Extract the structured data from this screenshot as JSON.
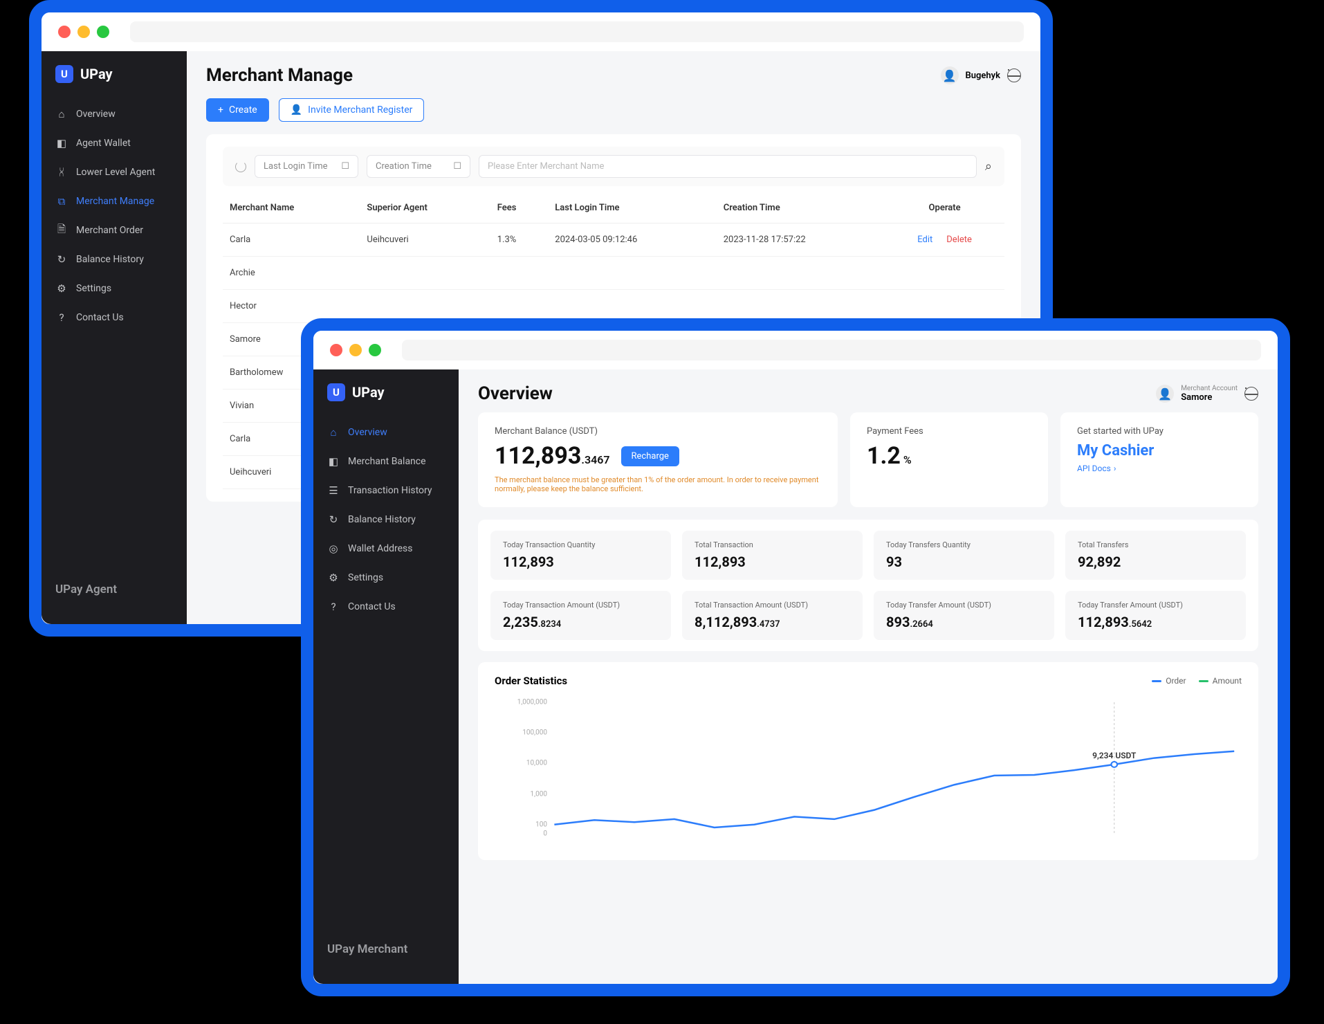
{
  "agent": {
    "appName": "UPay",
    "footer": "UPay Agent",
    "pageTitle": "Merchant Manage",
    "userName": "Bugehyk",
    "nav": [
      {
        "icon": "⌂",
        "label": "Overview"
      },
      {
        "icon": "◧",
        "label": "Agent Wallet"
      },
      {
        "icon": "⩆",
        "label": "Lower Level Agent"
      },
      {
        "icon": "⧉",
        "label": "Merchant Manage",
        "active": true
      },
      {
        "icon": "🗎",
        "label": "Merchant Order"
      },
      {
        "icon": "↻",
        "label": "Balance History"
      },
      {
        "icon": "⚙",
        "label": "Settings"
      },
      {
        "icon": "?",
        "label": "Contact Us"
      }
    ],
    "createBtn": "Create",
    "inviteBtn": "Invite Merchant Register",
    "filters": {
      "lastLogin": "Last Login Time",
      "creation": "Creation Time",
      "searchPlaceholder": "Please Enter Merchant Name"
    },
    "columns": [
      "Merchant Name",
      "Superior Agent",
      "Fees",
      "Last Login Time",
      "Creation Time",
      "Operate"
    ],
    "rows": [
      {
        "name": "Carla",
        "agent": "Ueihcuveri",
        "fees": "1.3%",
        "last": "2024-03-05  09:12:46",
        "created": "2023-11-28  17:57:22"
      },
      {
        "name": "Archie"
      },
      {
        "name": "Hector"
      },
      {
        "name": "Samore"
      },
      {
        "name": "Bartholomew"
      },
      {
        "name": "Vivian"
      },
      {
        "name": "Carla"
      },
      {
        "name": "Ueihcuveri"
      }
    ],
    "opEdit": "Edit",
    "opDelete": "Delete"
  },
  "merchant": {
    "appName": "UPay",
    "footer": "UPay Merchant",
    "pageTitle": "Overview",
    "userLabel": "Merchant Account",
    "userName": "Samore",
    "nav": [
      {
        "icon": "⌂",
        "label": "Overview",
        "active": true
      },
      {
        "icon": "◧",
        "label": "Merchant Balance"
      },
      {
        "icon": "☰",
        "label": "Transaction History"
      },
      {
        "icon": "↻",
        "label": "Balance History"
      },
      {
        "icon": "◎",
        "label": "Wallet Address"
      },
      {
        "icon": "⚙",
        "label": "Settings"
      },
      {
        "icon": "?",
        "label": "Contact Us"
      }
    ],
    "balance": {
      "label": "Merchant Balance (USDT)",
      "value": "112,893",
      "dec": ".3467",
      "recharge": "Recharge",
      "warn": "The merchant balance must be greater than 1% of the order amount. In order to receive payment normally, please keep the balance sufficient."
    },
    "fees": {
      "label": "Payment Fees",
      "value": "1.2",
      "unit": "%"
    },
    "getStarted": {
      "label": "Get started with UPay",
      "cashier": "My Cashier",
      "api": "API Docs"
    },
    "stats": [
      {
        "lbl": "Today Transaction Quantity",
        "val": "112,893"
      },
      {
        "lbl": "Total Transaction",
        "val": "112,893"
      },
      {
        "lbl": "Today Transfers Quantity",
        "val": "93"
      },
      {
        "lbl": "Total Transfers",
        "val": "92,892"
      },
      {
        "lbl": "Today Transaction Amount (USDT)",
        "val": "2,235",
        "dec": ".8234"
      },
      {
        "lbl": "Total Transaction Amount (USDT)",
        "val": "8,112,893",
        "dec": ".4737"
      },
      {
        "lbl": "Today Transfer Amount (USDT)",
        "val": "893",
        "dec": ".2664"
      },
      {
        "lbl": "Today Transfer Amount (USDT)",
        "val": "112,893",
        "dec": ".5642"
      }
    ],
    "chartTitle": "Order Statistics",
    "legend": {
      "order": "Order",
      "amount": "Amount"
    },
    "tooltip": "9,234 USDT"
  },
  "chart_data": {
    "type": "line",
    "title": "Order Statistics",
    "ylabel": "",
    "yscale": "log",
    "ylim": [
      0,
      1000000
    ],
    "yticks": [
      0,
      100,
      1000,
      10000,
      100000,
      1000000
    ],
    "ytick_labels": [
      "0",
      "100",
      "1,000",
      "10,000",
      "100,000",
      "1,000,000"
    ],
    "series": [
      {
        "name": "Order",
        "color": "#2c7dfb",
        "values": [
          100,
          140,
          120,
          150,
          80,
          100,
          180,
          150,
          300,
          800,
          2000,
          4000,
          4200,
          6000,
          9234,
          15000,
          20000,
          25000
        ]
      }
    ],
    "annotation": {
      "index": 14,
      "text": "9,234 USDT"
    },
    "legend": [
      "Order",
      "Amount"
    ]
  }
}
